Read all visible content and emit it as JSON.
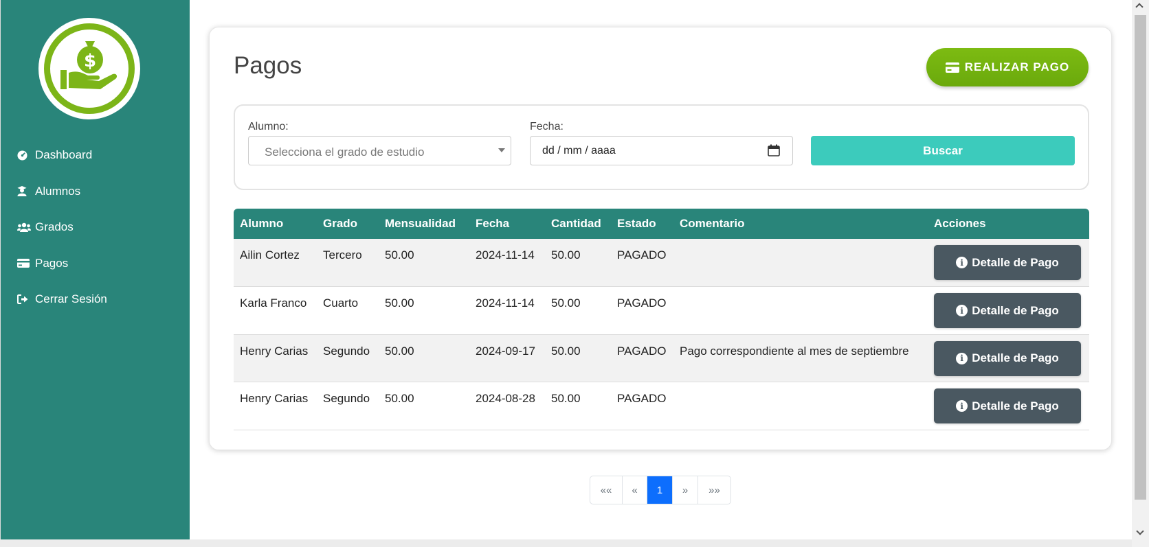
{
  "sidebar": {
    "logo_icon": "money-bag-hand-icon",
    "items": [
      {
        "label": "Dashboard",
        "icon": "gauge-icon"
      },
      {
        "label": "Alumnos",
        "icon": "student-icon"
      },
      {
        "label": "Grados",
        "icon": "users-icon"
      },
      {
        "label": "Pagos",
        "icon": "credit-card-icon"
      },
      {
        "label": "Cerrar Sesión",
        "icon": "sign-out-icon"
      }
    ]
  },
  "page": {
    "title": "Pagos",
    "pay_button": "REALIZAR PAGO"
  },
  "filters": {
    "student_label": "Alumno:",
    "student_placeholder": "Selecciona el grado de estudio",
    "date_label": "Fecha:",
    "date_value": "dd / mm / aaaa",
    "search_button": "Buscar"
  },
  "table": {
    "headers": [
      "Alumno",
      "Grado",
      "Mensualidad",
      "Fecha",
      "Cantidad",
      "Estado",
      "Comentario",
      "Acciones"
    ],
    "rows": [
      {
        "alumno": "Ailin Cortez",
        "grado": "Tercero",
        "mensualidad": "50.00",
        "fecha": "2024-11-14",
        "cantidad": "50.00",
        "estado": "PAGADO",
        "comentario": "",
        "accion": "Detalle de Pago"
      },
      {
        "alumno": "Karla Franco",
        "grado": "Cuarto",
        "mensualidad": "50.00",
        "fecha": "2024-11-14",
        "cantidad": "50.00",
        "estado": "PAGADO",
        "comentario": "",
        "accion": "Detalle de Pago"
      },
      {
        "alumno": "Henry Carias",
        "grado": "Segundo",
        "mensualidad": "50.00",
        "fecha": "2024-09-17",
        "cantidad": "50.00",
        "estado": "PAGADO",
        "comentario": "Pago correspondiente al mes de septiembre",
        "accion": "Detalle de Pago"
      },
      {
        "alumno": "Henry Carias",
        "grado": "Segundo",
        "mensualidad": "50.00",
        "fecha": "2024-08-28",
        "cantidad": "50.00",
        "estado": "PAGADO",
        "comentario": "",
        "accion": "Detalle de Pago"
      }
    ]
  },
  "pagination": {
    "first": "««",
    "prev": "«",
    "current": "1",
    "next": "»",
    "last": "»»"
  },
  "colors": {
    "sidebar": "#29857a",
    "brand_green": "#7cb518",
    "search_button": "#3ccbbc",
    "detail_button": "#4a5861",
    "active_page": "#0d6efd"
  }
}
